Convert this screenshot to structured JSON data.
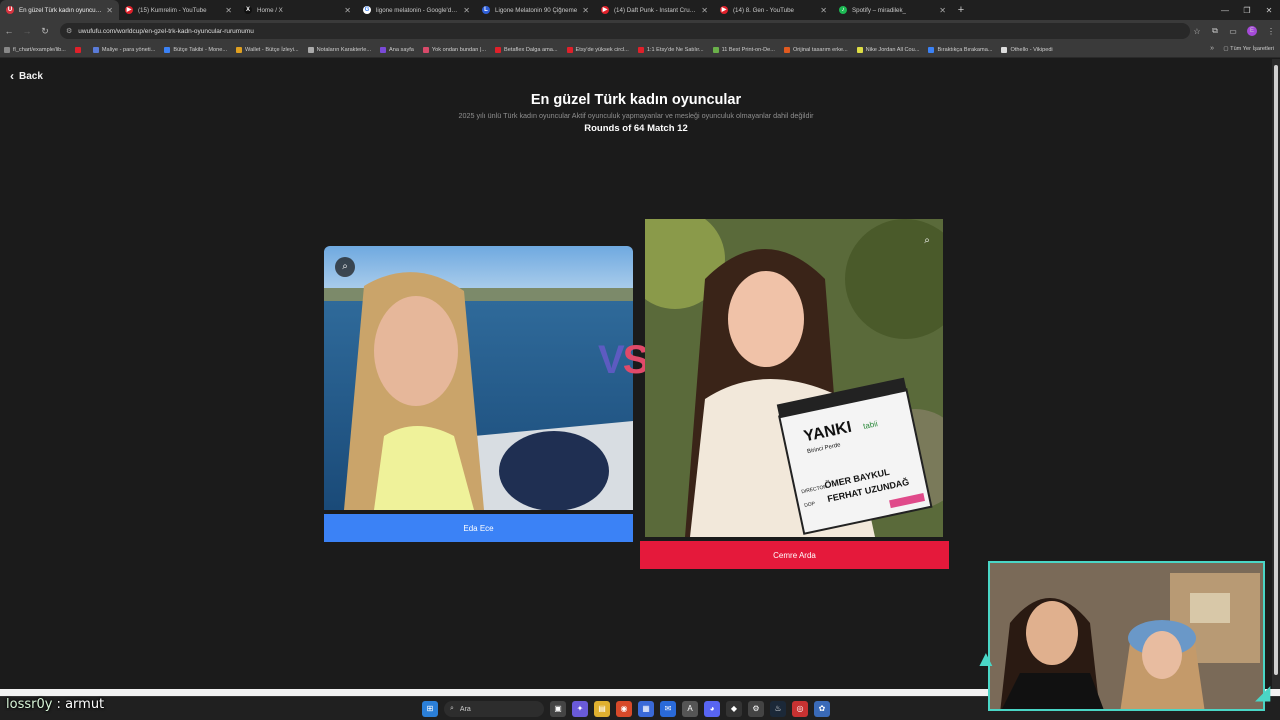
{
  "browser": {
    "tabs": [
      {
        "title": "En güzel Türk kadın oyuncular |",
        "favicon_color": "#d8333f",
        "favicon_text": "U"
      },
      {
        "title": "(15) Kumrelim - YouTube",
        "favicon_color": "#e0202a",
        "favicon_text": "▶"
      },
      {
        "title": "Home / X",
        "favicon_color": "#111111",
        "favicon_text": "X"
      },
      {
        "title": "ligone melatonin - Google'da A",
        "favicon_color": "#ffffff",
        "favicon_text": "G"
      },
      {
        "title": "Ligone Melatonin 90 Çiğneme",
        "favicon_color": "#2f5fd8",
        "favicon_text": "L"
      },
      {
        "title": "(14) Daft Punk - Instant Crush (",
        "favicon_color": "#e0202a",
        "favicon_text": "▶"
      },
      {
        "title": "(14) 8. Gen - YouTube",
        "favicon_color": "#e0202a",
        "favicon_text": "▶"
      },
      {
        "title": "Spotify – miradilek_",
        "favicon_color": "#1db954",
        "favicon_text": "♪"
      }
    ],
    "url": "uwufufu.com/worldcup/en-gzel-trk-kadn-oyuncular-rurumumu",
    "bookmarks": [
      {
        "label": "fl_chart/example/lib...",
        "color": "#888888"
      },
      {
        "label": "",
        "color": "#e0202a"
      },
      {
        "label": "Maliye - para yöneti...",
        "color": "#5a7bd8"
      },
      {
        "label": "Bütçe Takibi - Mone...",
        "color": "#3b82f6"
      },
      {
        "label": "Wallet - Bütçe İzleyi...",
        "color": "#e0a020"
      },
      {
        "label": "Notaların Karakterle...",
        "color": "#aaaaaa"
      },
      {
        "label": "Ana sayfa",
        "color": "#7a4ad8"
      },
      {
        "label": "Yok ondan bundan |...",
        "color": "#d84a6a"
      },
      {
        "label": "Betaflex Dalga ama...",
        "color": "#e0202a"
      },
      {
        "label": "Etsy'de yüksek circl...",
        "color": "#e0202a"
      },
      {
        "label": "1:1 Etsy'de Ne Satılır...",
        "color": "#e0202a"
      },
      {
        "label": "11 Best Print-on-De...",
        "color": "#6ab04a"
      },
      {
        "label": "Orijinal tasarım erke...",
        "color": "#e05a20"
      },
      {
        "label": "Nike Jordan All Cou...",
        "color": "#dddd44"
      },
      {
        "label": "Bıraktıkça Bırakama...",
        "color": "#3b82f6"
      },
      {
        "label": "Othello - Vikipedi",
        "color": "#dddddd"
      }
    ],
    "all_bookmarks_label": "Tüm Yer İşaretleri",
    "profile_initial": "E"
  },
  "page": {
    "back_label": "Back",
    "title": "En güzel Türk kadın oyuncular",
    "subtitle": "2025 yılı ünlü Türk kadın oyuncular Aktif oyunculuk yapmayanlar ve mesleği oyunculuk olmayanlar dahil değildir",
    "round_label": "Rounds of 64 Match 12",
    "vs_v": "V",
    "vs_s": "S",
    "left": {
      "name": "Eda Ece",
      "button_color": "#3b82f6"
    },
    "right": {
      "name": "Cemre Arda",
      "button_color": "#e5193b"
    }
  },
  "taskbar": {
    "search_placeholder": "Ara"
  },
  "chat": {
    "user": "lossr0y",
    "message": " : armut"
  },
  "clapper": {
    "line1": "YANKI",
    "line2": "Birinci Perde",
    "director_label": "DIRECTOR",
    "director": "ÖMER BAYKUL",
    "dop_label": "DOP",
    "dop": "FERHAT UZUNDAĞ",
    "brand": "tabii"
  }
}
